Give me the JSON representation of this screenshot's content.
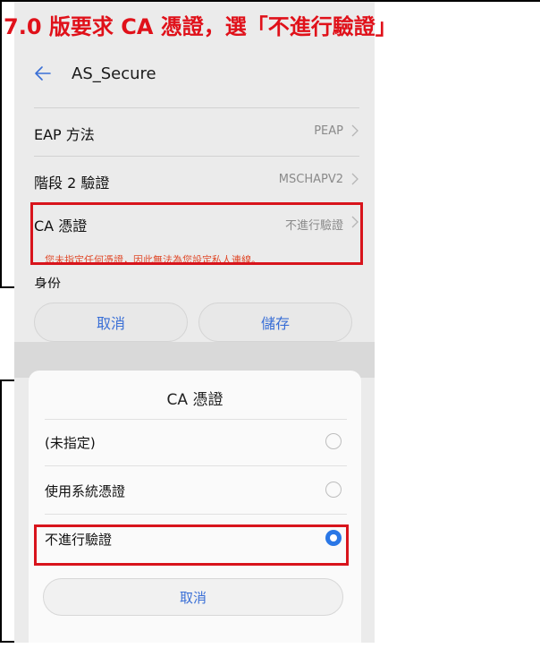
{
  "annotation": {
    "text": "7.0 版要求 CA 憑證，選「不進行驗證」",
    "color": "#e0111a"
  },
  "appbar": {
    "back_icon": "back-arrow-icon",
    "title": "AS_Secure"
  },
  "settings": {
    "rows": [
      {
        "label": "EAP 方法",
        "value": "PEAP",
        "icon": "chevron-right-icon"
      },
      {
        "label": "階段 2 驗證",
        "value": "MSCHAPV2",
        "icon": "chevron-right-icon"
      },
      {
        "label": "CA 憑證",
        "value": "不進行驗證",
        "icon": "chevron-right-icon"
      }
    ],
    "warning": "您未指定任何憑證，因此無法為您設定私人連線。",
    "identity_label": "身份"
  },
  "actions": {
    "cancel": "取消",
    "save": "儲存"
  },
  "sheet": {
    "title": "CA 憑證",
    "options": [
      {
        "label": "(未指定)",
        "selected": false
      },
      {
        "label": "使用系統憑證",
        "selected": false
      },
      {
        "label": "不進行驗證",
        "selected": true
      }
    ],
    "cancel": "取消"
  },
  "colors": {
    "accent": "#3a6fd6",
    "radio_selected": "#2a77e6",
    "highlight_box": "#d8141c",
    "warning_text": "#e04a2a"
  }
}
